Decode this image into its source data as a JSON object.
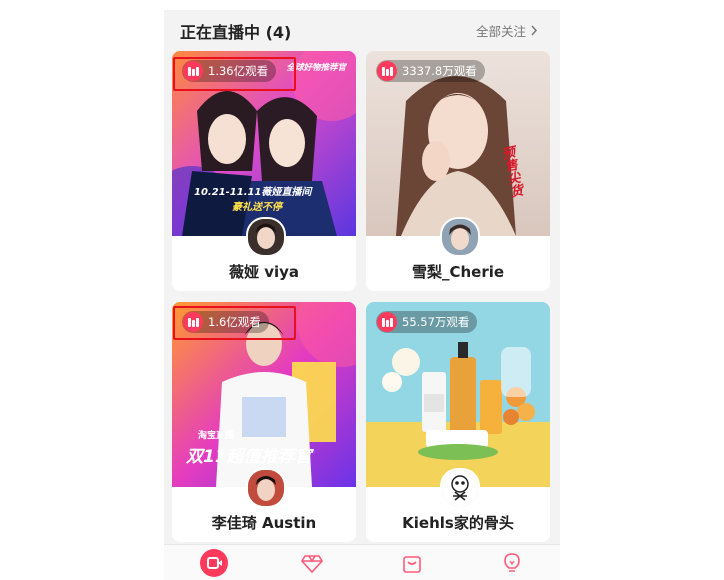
{
  "header": {
    "title": "正在直播中 (4)",
    "follow_all": "全部关注"
  },
  "cards": [
    {
      "views": "1.36亿观看",
      "name": "薇娅 viya",
      "overlay_tag": "全球好物推荐官",
      "overlay_date": "10.21-11.11薇娅直播间",
      "overlay_sub": "豪礼送不停"
    },
    {
      "views": "3337.8万观看",
      "name": "雪梨_Cherie",
      "overlay_tag": "预售尖货"
    },
    {
      "views": "1.6亿观看",
      "name": "李佳琦 Austin",
      "overlay_brand": "淘宝直播",
      "overlay_slogan": "双11超值推荐官"
    },
    {
      "views": "55.57万观看",
      "name": "Kiehls家的骨头"
    }
  ],
  "tabbar": {
    "items": [
      "live-icon",
      "gem-icon",
      "bag-icon",
      "lightbulb-icon"
    ]
  },
  "colors": {
    "accent": "#ff3a5c",
    "highlight": "#e8101c"
  }
}
